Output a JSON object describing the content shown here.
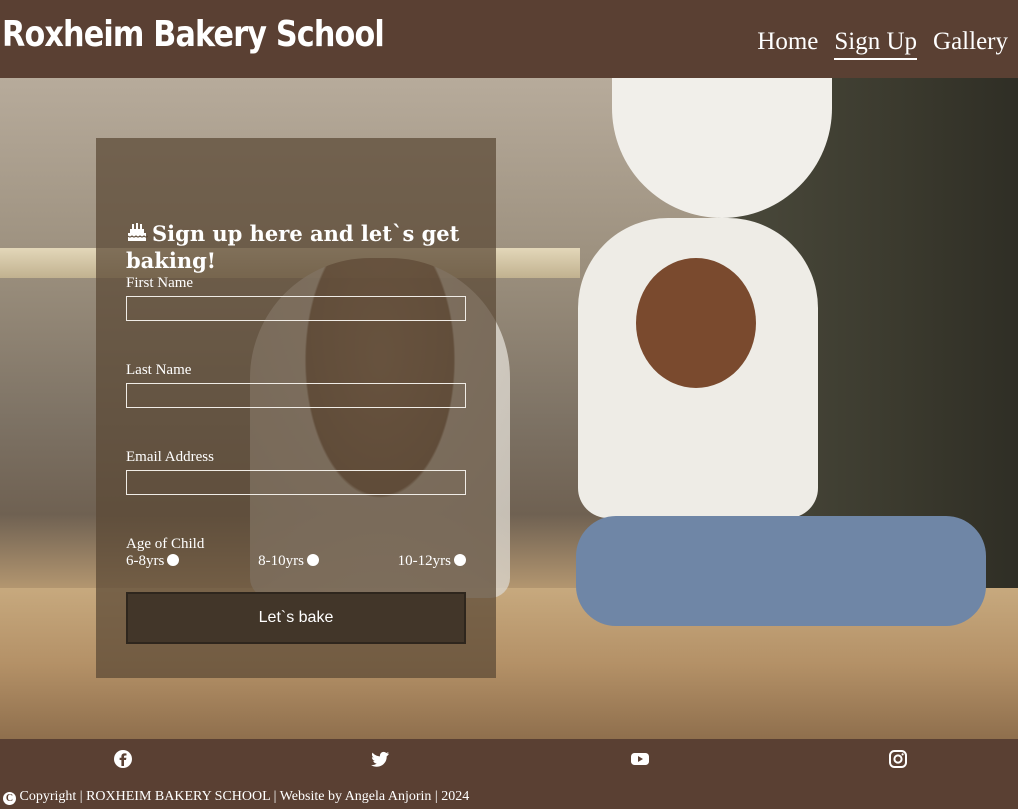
{
  "header": {
    "brand": "Roxheim Bakery School",
    "nav": [
      {
        "label": "Home",
        "active": false
      },
      {
        "label": "Sign Up",
        "active": true
      },
      {
        "label": "Gallery",
        "active": false
      }
    ]
  },
  "form": {
    "title": "Sign up here and let`s get baking!",
    "title_icon": "cake-icon",
    "first_name_label": "First Name",
    "last_name_label": "Last Name",
    "email_label": "Email Address",
    "age_label": "Age of Child",
    "age_options": [
      "6-8yrs",
      "8-10yrs",
      "10-12yrs"
    ],
    "submit_label": "Let`s bake"
  },
  "footer": {
    "socials": [
      "facebook-icon",
      "twitter-icon",
      "youtube-icon",
      "instagram-icon"
    ],
    "copyright": "Copyright | ROXHEIM BAKERY SCHOOL | Website by Angela Anjorin | 2024"
  },
  "colors": {
    "header_bg": "#5a4033",
    "panel_bg": "#5a4834",
    "button_bg": "#423629",
    "text": "#ffffff"
  }
}
